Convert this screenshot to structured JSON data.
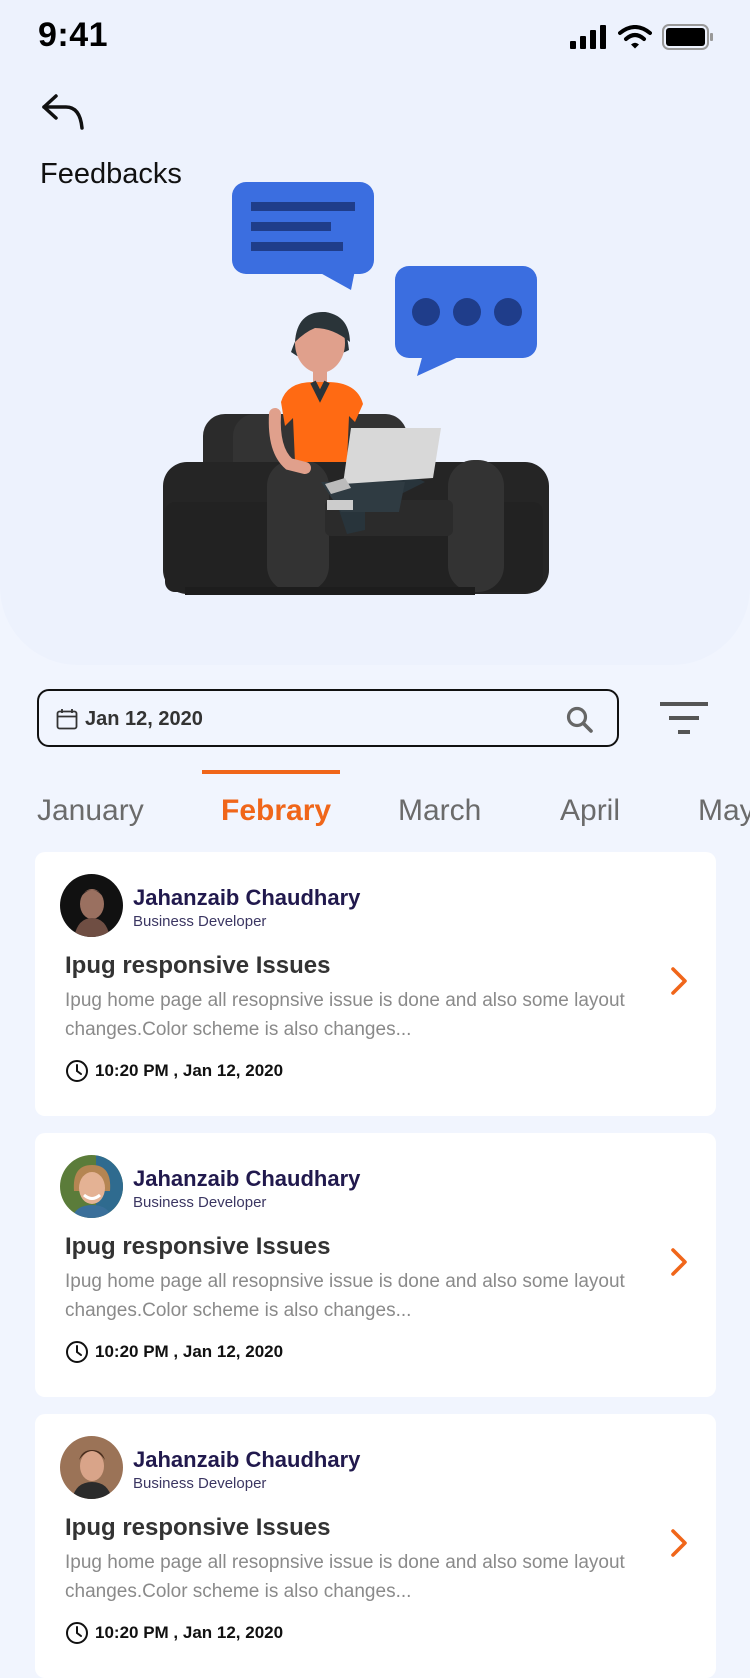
{
  "status_bar": {
    "time": "9:41"
  },
  "header": {
    "title": "Feedbacks"
  },
  "search": {
    "value": "Jan 12, 2020"
  },
  "months": [
    "January",
    "Febrary",
    "March",
    "April",
    "May"
  ],
  "active_month": "Febrary",
  "colors": {
    "accent": "#f0661a",
    "background": "#f1f5fe",
    "bubble": "#3b6ee0",
    "name": "#21194d"
  },
  "feedbacks": [
    {
      "author": "Jahanzaib Chaudhary",
      "role": "Business Developer",
      "title": "Ipug responsive Issues",
      "description": "Ipug home page all resopnsive issue is done and also some layout changes.Color scheme is also changes...",
      "time": "10:20 PM , Jan 12, 2020"
    },
    {
      "author": "Jahanzaib Chaudhary",
      "role": "Business Developer",
      "title": "Ipug responsive Issues",
      "description": "Ipug home page all resopnsive issue is done and also some layout changes.Color scheme is also changes...",
      "time": "10:20 PM , Jan 12, 2020"
    },
    {
      "author": "Jahanzaib Chaudhary",
      "role": "Business Developer",
      "title": "Ipug responsive Issues",
      "description": "Ipug home page all resopnsive issue is done and also some layout changes.Color scheme is also changes...",
      "time": "10:20 PM , Jan 12, 2020"
    }
  ],
  "icons": [
    "back-arrow-icon",
    "calendar-icon",
    "search-icon",
    "filter-icon",
    "clock-icon",
    "chevron-right-icon",
    "signal-icon",
    "wifi-icon",
    "battery-icon"
  ]
}
